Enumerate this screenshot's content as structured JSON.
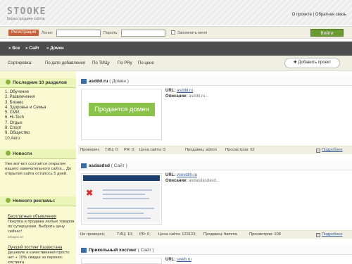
{
  "header": {
    "logo": "STOOKE",
    "tagline": "Биржа продажи сайтов",
    "about": "О проекте",
    "feedback": "Обратная связь",
    "separator": "|"
  },
  "login": {
    "register_label": "Регистрация",
    "login_label": "Логин:",
    "password_label": "Пароль:",
    "remember_label": "Запомнить меня",
    "submit_label": "Войти"
  },
  "nav": {
    "items": [
      "Все",
      "Сайт",
      "Домен"
    ]
  },
  "sort": {
    "label": "Сортировка:",
    "options": [
      "По дате добавления",
      "По ТИЦу",
      "По PRу",
      "По цене"
    ],
    "add_label": "Добавить проект"
  },
  "sidebar": {
    "sections": [
      "Последние 10 разделов",
      "Новости",
      "Немного рекламы:"
    ],
    "categories": [
      "1. Обучение",
      "2. Развлечения",
      "3. Бизнес",
      "4. Здоровье и Семья",
      "5. СМИ",
      "6. Hi-Tech",
      "7. Отдых",
      "8. Спорт",
      "9. Общество",
      "10.Авто"
    ],
    "news": "Уже вот-вот состоится открытие нашего замечательного сайта... До открытия сайта осталось 5 дней.",
    "ads": [
      {
        "title": "Бесплатные объявления",
        "text": "Покупка и продажа любых товаров по суперценам. Выбрать цену сейчас!",
        "url": "arbagno.kz"
      },
      {
        "title": "Лучший хостинг Казахстана",
        "text": "Дешевле и качественней просто нет + 10% скидка за перенос хостинга"
      }
    ]
  },
  "listings": [
    {
      "title": "asddd.ru",
      "type": "( Домен )",
      "url_label": "URL:",
      "url": "asddd.ru",
      "desc_label": "Описание:",
      "desc": "asddd.ru...",
      "badge": "Продается домен",
      "stats": [
        "Проверен;",
        "ТИЦ: 0;",
        "PR: 0;",
        "Цена сайта: 0;",
        "Продавец: admin",
        "Просмотров: 62"
      ],
      "more": "Подробнее"
    },
    {
      "title": "asdasdsd",
      "type": "( Сайт )",
      "url_label": "URL:",
      "url": "vcevdim.ru",
      "desc_label": "Описание:",
      "desc": "asdasdasdasd...",
      "stats": [
        "Не проверен;",
        "ТИЦ: 10;",
        "PR: 0;",
        "Цена сайта: 123123;",
        "Продавец: fiamma",
        "Просмотров: 108"
      ],
      "more": "Подробнее"
    },
    {
      "title": "Прикольный хостинг",
      "type": "( Сайт )",
      "url_label": "URL:",
      "url": "sweb.ru"
    }
  ]
}
